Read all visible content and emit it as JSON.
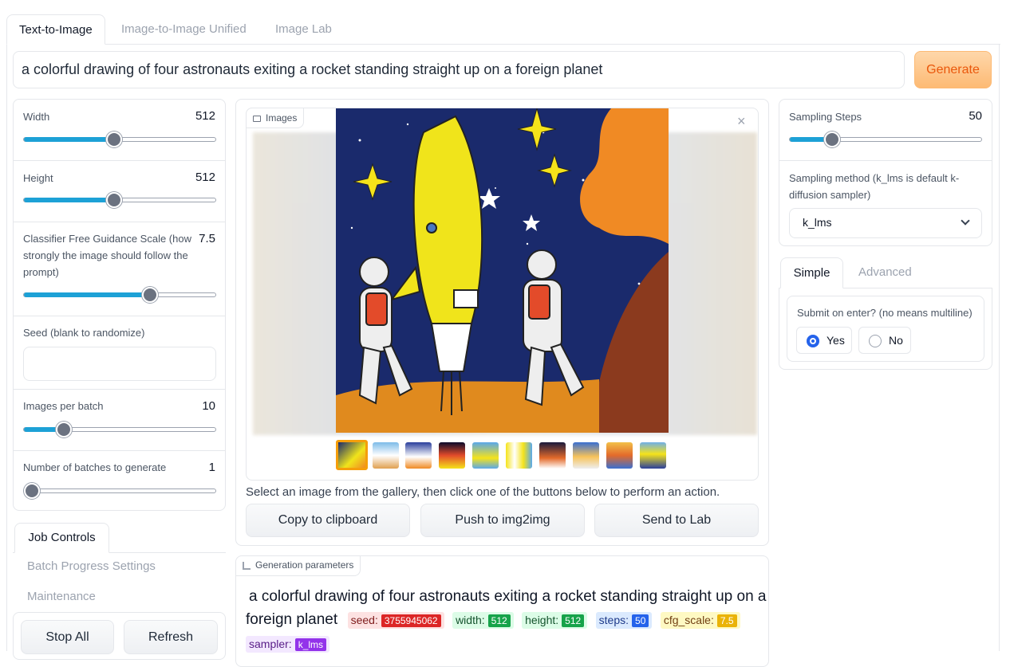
{
  "tabs": [
    "Text-to-Image",
    "Image-to-Image Unified",
    "Image Lab"
  ],
  "prompt": "a colorful drawing of four astronauts exiting a rocket standing straight up on a foreign planet",
  "generate_label": "Generate",
  "colors": {
    "accent": "#1da1d6",
    "generate": "#fdba74",
    "generate_text": "#ea580c"
  },
  "left": {
    "sliders": [
      {
        "label": "Width",
        "value": "512",
        "fraction": 0.47
      },
      {
        "label": "Height",
        "value": "512",
        "fraction": 0.47
      },
      {
        "label": "Classifier Free Guidance Scale (how strongly the image should follow the prompt)",
        "value": "7.5",
        "fraction": 0.66
      },
      {
        "label": "Images per batch",
        "value": "10",
        "fraction": 0.21
      },
      {
        "label": "Number of batches to generate",
        "value": "1",
        "fraction": 0.04
      }
    ],
    "seed_label": "Seed (blank to randomize)",
    "seed_value": "",
    "job_tabs": [
      "Job Controls",
      "Batch Progress Settings",
      "Maintenance"
    ],
    "stop_all": "Stop All",
    "refresh": "Refresh"
  },
  "gallery": {
    "label": "Images",
    "close_icon": "×",
    "instruction": "Select an image from the gallery, then click one of the buttons below to perform an action.",
    "actions": [
      "Copy to clipboard",
      "Push to img2img",
      "Send to Lab"
    ]
  },
  "params": {
    "label": "Generation parameters",
    "text_line1": "a colorful drawing of four astronauts exiting a rocket standing straight up on a",
    "text_line2": "foreign planet",
    "seed_label": "seed:",
    "seed": "3755945062",
    "width_label": "width:",
    "width": "512",
    "height_label": "height:",
    "height": "512",
    "steps_label": "steps:",
    "steps": "50",
    "cfg_label": "cfg_scale:",
    "cfg": "7.5",
    "sampler_label": "sampler:",
    "sampler": "k_lms"
  },
  "right": {
    "steps_label": "Sampling Steps",
    "steps_value": "50",
    "steps_fraction": 0.22,
    "method_label": "Sampling method (k_lms is default k-diffusion sampler)",
    "method_value": "k_lms",
    "mode_tabs": [
      "Simple",
      "Advanced"
    ],
    "submit_label": "Submit on enter? (no means multiline)",
    "options": [
      "Yes",
      "No"
    ],
    "selected": "Yes"
  }
}
